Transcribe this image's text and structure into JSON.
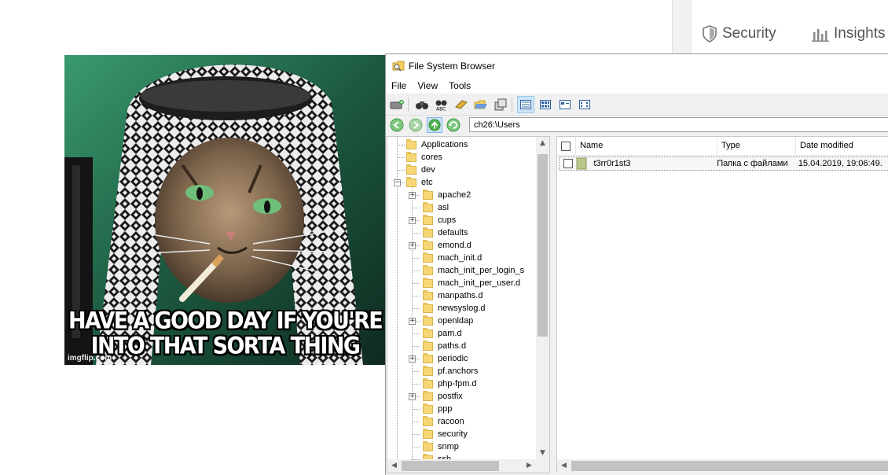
{
  "background_tabs": [
    {
      "label": "Security",
      "icon": "shield-icon"
    },
    {
      "label": "Insights",
      "icon": "bar-chart-icon"
    }
  ],
  "meme": {
    "caption_line1": "HAVE A GOOD DAY IF YOU'RE",
    "caption_line2": "INTO THAT SORTA THING",
    "watermark": "imgflip.com"
  },
  "window": {
    "title": "File System Browser",
    "menu": [
      "File",
      "View",
      "Tools"
    ],
    "toolbar_icons": [
      "add-drive-icon",
      "binoculars-icon",
      "find-text-icon",
      "rename-icon",
      "open-folder-icon",
      "copy-icon",
      "details-view-icon",
      "large-icons-view-icon",
      "list-view-icon",
      "small-icons-view-icon"
    ],
    "nav_icons": [
      "back-icon",
      "forward-icon",
      "up-icon",
      "refresh-icon"
    ],
    "address": "ch26:\\Users"
  },
  "tree": {
    "items": [
      {
        "label": "Applications",
        "level": 0,
        "expander": ""
      },
      {
        "label": "cores",
        "level": 0,
        "expander": ""
      },
      {
        "label": "dev",
        "level": 0,
        "expander": ""
      },
      {
        "label": "etc",
        "level": 0,
        "expander": "−"
      },
      {
        "label": "apache2",
        "level": 1,
        "expander": "+"
      },
      {
        "label": "asl",
        "level": 1,
        "expander": ""
      },
      {
        "label": "cups",
        "level": 1,
        "expander": "+"
      },
      {
        "label": "defaults",
        "level": 1,
        "expander": ""
      },
      {
        "label": "emond.d",
        "level": 1,
        "expander": "+"
      },
      {
        "label": "mach_init.d",
        "level": 1,
        "expander": ""
      },
      {
        "label": "mach_init_per_login_s",
        "level": 1,
        "expander": ""
      },
      {
        "label": "mach_init_per_user.d",
        "level": 1,
        "expander": ""
      },
      {
        "label": "manpaths.d",
        "level": 1,
        "expander": ""
      },
      {
        "label": "newsyslog.d",
        "level": 1,
        "expander": ""
      },
      {
        "label": "openldap",
        "level": 1,
        "expander": "+"
      },
      {
        "label": "pam.d",
        "level": 1,
        "expander": ""
      },
      {
        "label": "paths.d",
        "level": 1,
        "expander": ""
      },
      {
        "label": "periodic",
        "level": 1,
        "expander": "+"
      },
      {
        "label": "pf.anchors",
        "level": 1,
        "expander": ""
      },
      {
        "label": "php-fpm.d",
        "level": 1,
        "expander": ""
      },
      {
        "label": "postfix",
        "level": 1,
        "expander": "+"
      },
      {
        "label": "ppp",
        "level": 1,
        "expander": ""
      },
      {
        "label": "racoon",
        "level": 1,
        "expander": ""
      },
      {
        "label": "security",
        "level": 1,
        "expander": ""
      },
      {
        "label": "snmp",
        "level": 1,
        "expander": ""
      },
      {
        "label": "ssh",
        "level": 1,
        "expander": ""
      }
    ]
  },
  "list": {
    "columns": [
      "Name",
      "Type",
      "Date modified"
    ],
    "rows": [
      {
        "name": "t3rr0r1st3",
        "type": "Папка с файлами",
        "date": "15.04.2019, 19:06:49."
      }
    ]
  }
}
